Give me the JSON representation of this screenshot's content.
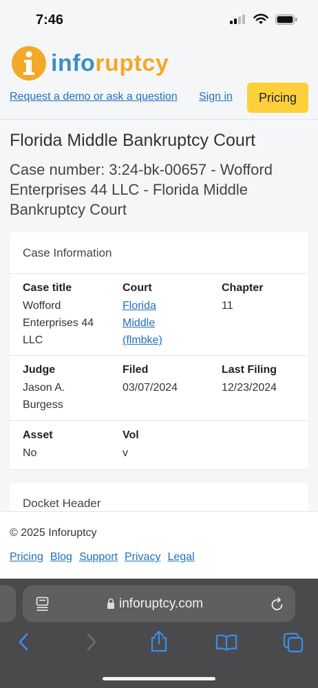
{
  "status_bar": {
    "time": "7:46"
  },
  "header": {
    "logo_text_a": "info",
    "logo_text_b": "ruptcy",
    "nav": {
      "demo_link": "Request a demo or ask a question",
      "signin_link": "Sign in",
      "pricing_button": "Pricing"
    }
  },
  "page": {
    "title": "Florida Middle Bankruptcy Court",
    "subtitle": "Case number: 3:24-bk-00657 - Wofford Enterprises 44 LLC - Florida Middle Bankruptcy Court"
  },
  "case_info": {
    "header": "Case Information",
    "case_title_label": "Case title",
    "case_title_value": "Wofford Enterprises 44 LLC",
    "court_label": "Court",
    "court_value": "Florida Middle (flmbke)",
    "chapter_label": "Chapter",
    "chapter_value": "11",
    "judge_label": "Judge",
    "judge_value": "Jason A. Burgess",
    "filed_label": "Filed",
    "filed_value": "03/07/2024",
    "last_filing_label": "Last Filing",
    "last_filing_value": "12/23/2024",
    "asset_label": "Asset",
    "asset_value": "No",
    "vol_label": "Vol",
    "vol_value": "v"
  },
  "docket": {
    "header": "Docket Header"
  },
  "footer": {
    "copyright": "© 2025 Inforuptcy",
    "links": [
      "Pricing",
      "Blog",
      "Support",
      "Privacy",
      "Legal"
    ]
  },
  "browser": {
    "url": "inforuptcy.com"
  },
  "colors": {
    "accent": "#1f6fbf",
    "pricing": "#fdd03b",
    "logo_blue": "#3a8fc7",
    "logo_orange": "#f2a928"
  }
}
